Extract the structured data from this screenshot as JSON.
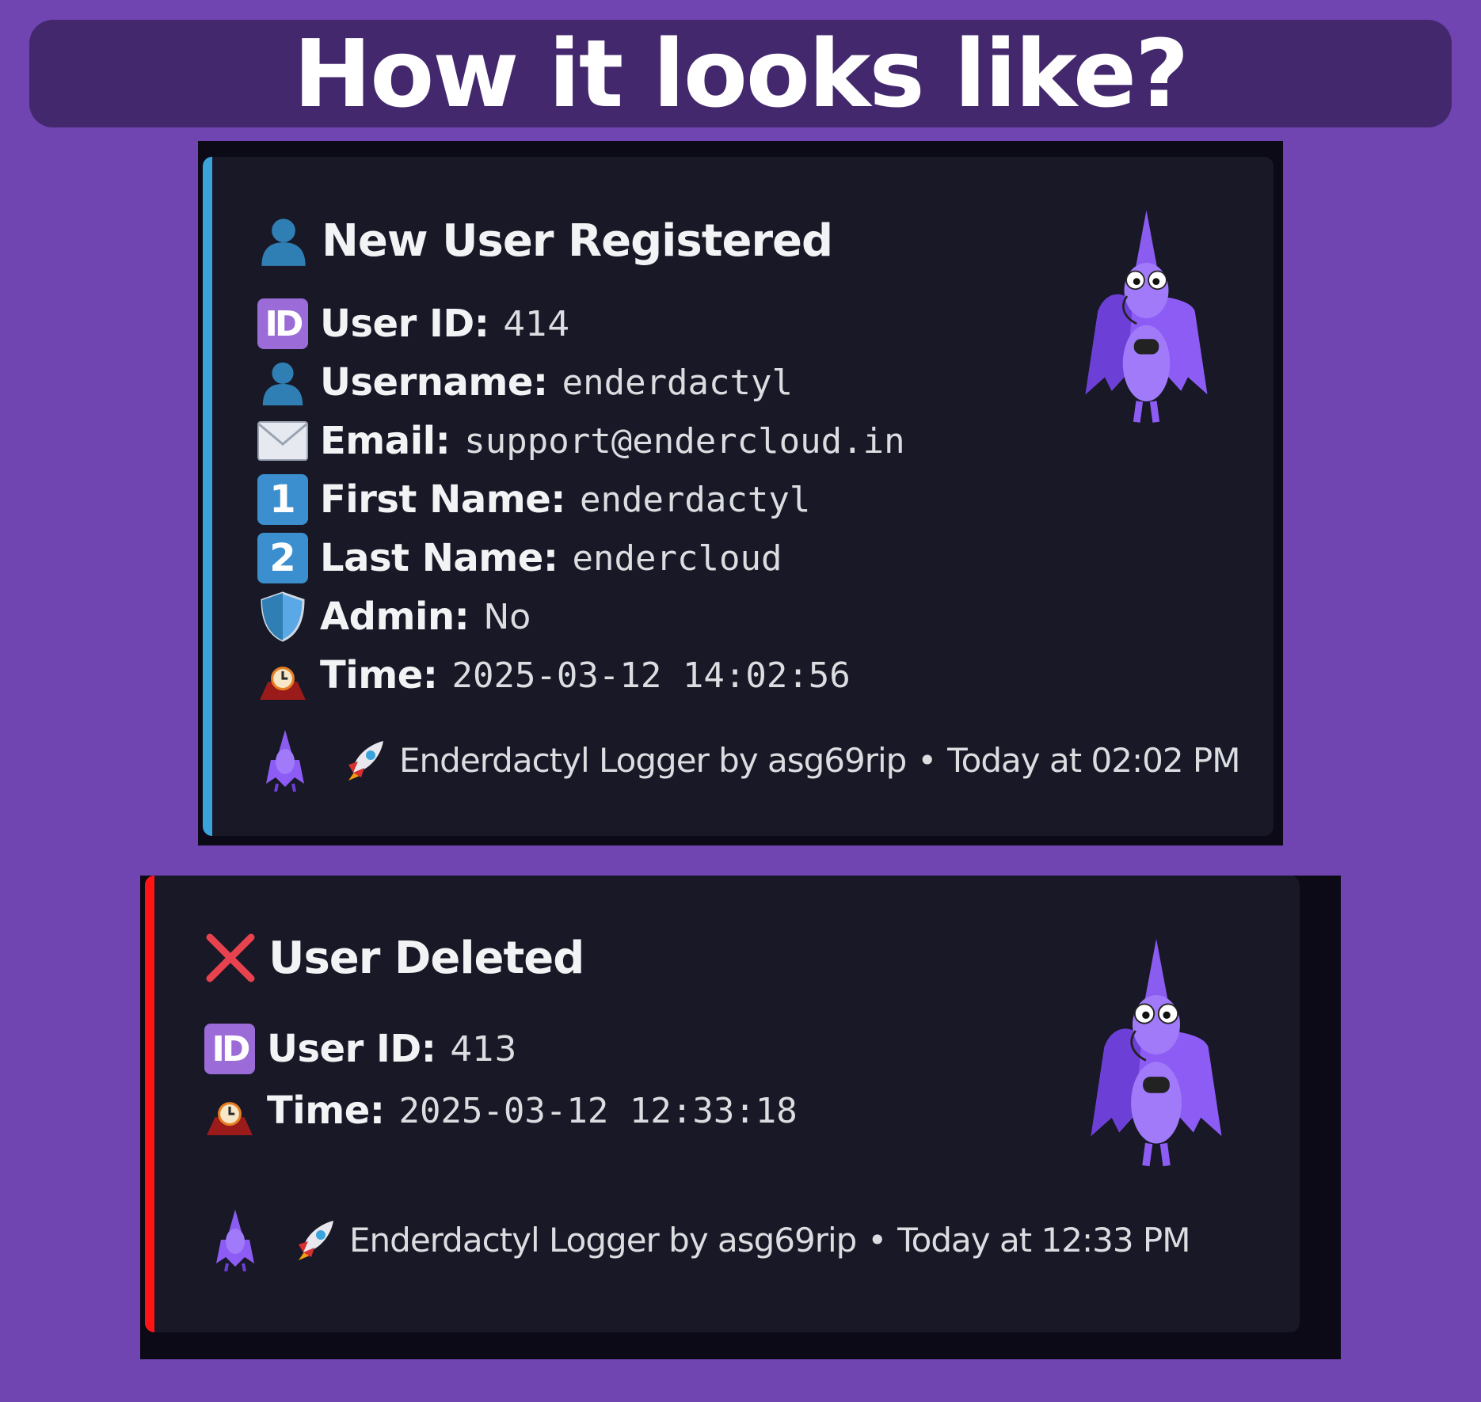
{
  "banner": {
    "title": "How it looks like?"
  },
  "colors": {
    "background": "#7044b1",
    "banner": "#44286e",
    "card": "#181826",
    "accent_register": "#3ba3dc",
    "accent_delete": "#ff1414"
  },
  "embeds": [
    {
      "title": "New User Registered",
      "title_icon": "bust-in-silhouette-icon",
      "fields": [
        {
          "icon": "id-icon",
          "label": "User ID:",
          "value": "414"
        },
        {
          "icon": "bust-in-silhouette-icon",
          "label": "Username:",
          "value": "enderdactyl"
        },
        {
          "icon": "envelope-icon",
          "label": "Email:",
          "value": "support@endercloud.in"
        },
        {
          "icon": "keycap-1-icon",
          "label": "First Name:",
          "value": "enderdactyl"
        },
        {
          "icon": "keycap-2-icon",
          "label": "Last Name:",
          "value": "endercloud"
        },
        {
          "icon": "shield-icon",
          "label": "Admin:",
          "value": "No"
        },
        {
          "icon": "mantelpiece-clock-icon",
          "label": "Time:",
          "value": "2025-03-12 14:02:56"
        }
      ],
      "footer": {
        "text": "Enderdactyl Logger by asg69rip",
        "separator": "•",
        "timestamp": "Today at 02:02 PM"
      }
    },
    {
      "title": "User Deleted",
      "title_icon": "cross-mark-icon",
      "fields": [
        {
          "icon": "id-icon",
          "label": "User ID:",
          "value": "413"
        },
        {
          "icon": "mantelpiece-clock-icon",
          "label": "Time:",
          "value": "2025-03-12 12:33:18"
        }
      ],
      "footer": {
        "text": "Enderdactyl Logger by asg69rip",
        "separator": "•",
        "timestamp": "Today at 12:33 PM"
      }
    }
  ]
}
